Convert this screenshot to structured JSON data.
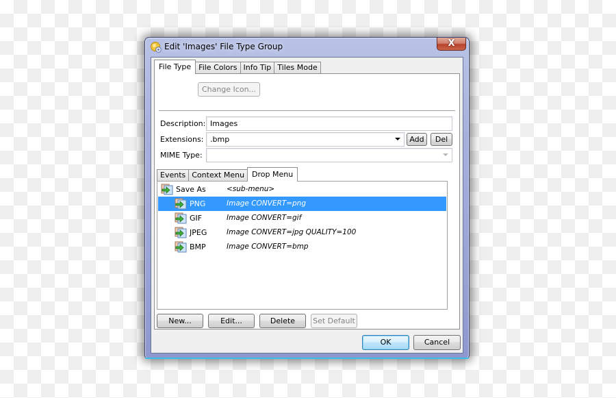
{
  "window": {
    "title": "Edit 'Images' File Type Group",
    "close_label": "X"
  },
  "tabs": [
    {
      "label": "File Type",
      "active": true
    },
    {
      "label": "File Colors",
      "active": false
    },
    {
      "label": "Info Tip",
      "active": false
    },
    {
      "label": "Tiles Mode",
      "active": false
    }
  ],
  "file_type": {
    "change_icon_label": "Change Icon...",
    "description_label": "Description:",
    "description_value": "Images",
    "extensions_label": "Extensions:",
    "extensions_value": ".bmp",
    "add_label": "Add",
    "del_label": "Del",
    "mime_label": "MIME Type:",
    "mime_value": ""
  },
  "inner_tabs": [
    {
      "label": "Events",
      "active": false
    },
    {
      "label": "Context Menu",
      "active": false
    },
    {
      "label": "Drop Menu",
      "active": true
    }
  ],
  "drop_menu": {
    "items": [
      {
        "name": "Save As",
        "command": "<sub-menu>",
        "level": 0,
        "selected": false
      },
      {
        "name": "PNG",
        "command": "Image CONVERT=png",
        "level": 1,
        "selected": true
      },
      {
        "name": "GIF",
        "command": "Image CONVERT=gif",
        "level": 1,
        "selected": false
      },
      {
        "name": "JPEG",
        "command": "Image CONVERT=jpg QUALITY=100",
        "level": 1,
        "selected": false
      },
      {
        "name": "BMP",
        "command": "Image CONVERT=bmp",
        "level": 1,
        "selected": false
      }
    ],
    "new_label": "New...",
    "edit_label": "Edit...",
    "delete_label": "Delete",
    "set_default_label": "Set Default"
  },
  "footer": {
    "ok_label": "OK",
    "cancel_label": "Cancel"
  },
  "colors": {
    "selection": "#3399ff",
    "frame": "#9aa3d6",
    "close": "#c8654a"
  }
}
